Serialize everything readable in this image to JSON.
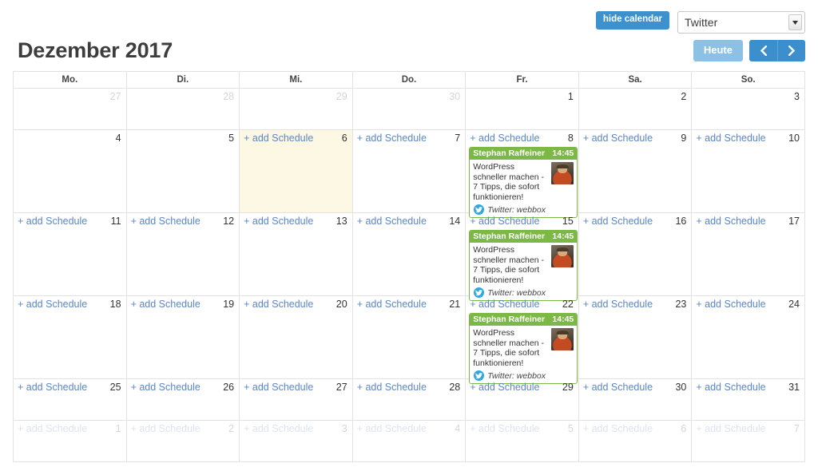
{
  "toolbar": {
    "hide_calendar_label": "hide calendar",
    "calendar_select_value": "Twitter",
    "calendar_select_options": [
      "Twitter"
    ],
    "today_label": "Heute",
    "prev_icon": "chevron-left-icon",
    "next_icon": "chevron-right-icon",
    "accent_blue": "#3b92cf",
    "today_blue": "#8cc0e4"
  },
  "header": {
    "month_title": "Dezember 2017"
  },
  "calendar": {
    "add_schedule_label": "+ add Schedule",
    "weekday_headers": [
      "Mo.",
      "Di.",
      "Mi.",
      "Do.",
      "Fr.",
      "Sa.",
      "So."
    ],
    "event_green": "#7cb944",
    "today_bg": "#fcf8e3",
    "weeks": [
      {
        "tall": false,
        "days": [
          {
            "num": "27",
            "muted": true,
            "add": false,
            "today": false,
            "event": null
          },
          {
            "num": "28",
            "muted": true,
            "add": false,
            "today": false,
            "event": null
          },
          {
            "num": "29",
            "muted": true,
            "add": false,
            "today": false,
            "event": null
          },
          {
            "num": "30",
            "muted": true,
            "add": false,
            "today": false,
            "event": null
          },
          {
            "num": "1",
            "muted": false,
            "add": false,
            "today": false,
            "event": null
          },
          {
            "num": "2",
            "muted": false,
            "add": false,
            "today": false,
            "event": null
          },
          {
            "num": "3",
            "muted": false,
            "add": false,
            "today": false,
            "event": null
          }
        ]
      },
      {
        "tall": true,
        "days": [
          {
            "num": "4",
            "muted": false,
            "add": false,
            "today": false,
            "event": null
          },
          {
            "num": "5",
            "muted": false,
            "add": false,
            "today": false,
            "event": null
          },
          {
            "num": "6",
            "muted": false,
            "add": true,
            "today": true,
            "event": null
          },
          {
            "num": "7",
            "muted": false,
            "add": true,
            "today": false,
            "event": null
          },
          {
            "num": "8",
            "muted": false,
            "add": true,
            "today": false,
            "event": 0
          },
          {
            "num": "9",
            "muted": false,
            "add": true,
            "today": false,
            "event": null
          },
          {
            "num": "10",
            "muted": false,
            "add": true,
            "today": false,
            "event": null
          }
        ]
      },
      {
        "tall": true,
        "days": [
          {
            "num": "11",
            "muted": false,
            "add": true,
            "today": false,
            "event": null
          },
          {
            "num": "12",
            "muted": false,
            "add": true,
            "today": false,
            "event": null
          },
          {
            "num": "13",
            "muted": false,
            "add": true,
            "today": false,
            "event": null
          },
          {
            "num": "14",
            "muted": false,
            "add": true,
            "today": false,
            "event": null
          },
          {
            "num": "15",
            "muted": false,
            "add": true,
            "today": false,
            "event": 1
          },
          {
            "num": "16",
            "muted": false,
            "add": true,
            "today": false,
            "event": null
          },
          {
            "num": "17",
            "muted": false,
            "add": true,
            "today": false,
            "event": null
          }
        ]
      },
      {
        "tall": true,
        "days": [
          {
            "num": "18",
            "muted": false,
            "add": true,
            "today": false,
            "event": null
          },
          {
            "num": "19",
            "muted": false,
            "add": true,
            "today": false,
            "event": null
          },
          {
            "num": "20",
            "muted": false,
            "add": true,
            "today": false,
            "event": null
          },
          {
            "num": "21",
            "muted": false,
            "add": true,
            "today": false,
            "event": null
          },
          {
            "num": "22",
            "muted": false,
            "add": true,
            "today": false,
            "event": 2
          },
          {
            "num": "23",
            "muted": false,
            "add": true,
            "today": false,
            "event": null
          },
          {
            "num": "24",
            "muted": false,
            "add": true,
            "today": false,
            "event": null
          }
        ]
      },
      {
        "tall": false,
        "days": [
          {
            "num": "25",
            "muted": false,
            "add": true,
            "today": false,
            "event": null
          },
          {
            "num": "26",
            "muted": false,
            "add": true,
            "today": false,
            "event": null
          },
          {
            "num": "27",
            "muted": false,
            "add": true,
            "today": false,
            "event": null
          },
          {
            "num": "28",
            "muted": false,
            "add": true,
            "today": false,
            "event": null
          },
          {
            "num": "29",
            "muted": false,
            "add": true,
            "today": false,
            "event": null
          },
          {
            "num": "30",
            "muted": false,
            "add": true,
            "today": false,
            "event": null
          },
          {
            "num": "31",
            "muted": false,
            "add": true,
            "today": false,
            "event": null
          }
        ]
      },
      {
        "tall": false,
        "days": [
          {
            "num": "1",
            "muted": true,
            "add": true,
            "today": false,
            "event": null
          },
          {
            "num": "2",
            "muted": true,
            "add": true,
            "today": false,
            "event": null
          },
          {
            "num": "3",
            "muted": true,
            "add": true,
            "today": false,
            "event": null
          },
          {
            "num": "4",
            "muted": true,
            "add": true,
            "today": false,
            "event": null
          },
          {
            "num": "5",
            "muted": true,
            "add": true,
            "today": false,
            "event": null
          },
          {
            "num": "6",
            "muted": true,
            "add": true,
            "today": false,
            "event": null
          },
          {
            "num": "7",
            "muted": true,
            "add": true,
            "today": false,
            "event": null
          }
        ]
      }
    ],
    "events": [
      {
        "author": "Stephan Raffeiner",
        "time": "14:45",
        "text": "WordPress schneller machen - 7 Tipps, die sofort funktionieren!",
        "source": "Twitter: webbox",
        "source_icon": "twitter-bird-icon",
        "avatar_icon": "user-avatar-photo"
      },
      {
        "author": "Stephan Raffeiner",
        "time": "14:45",
        "text": "WordPress schneller machen - 7 Tipps, die sofort funktionieren!",
        "source": "Twitter: webbox",
        "source_icon": "twitter-bird-icon",
        "avatar_icon": "user-avatar-photo"
      },
      {
        "author": "Stephan Raffeiner",
        "time": "14:45",
        "text": "WordPress schneller machen - 7 Tipps, die sofort funktionieren!",
        "source": "Twitter: webbox",
        "source_icon": "twitter-bird-icon",
        "avatar_icon": "user-avatar-photo"
      }
    ]
  }
}
